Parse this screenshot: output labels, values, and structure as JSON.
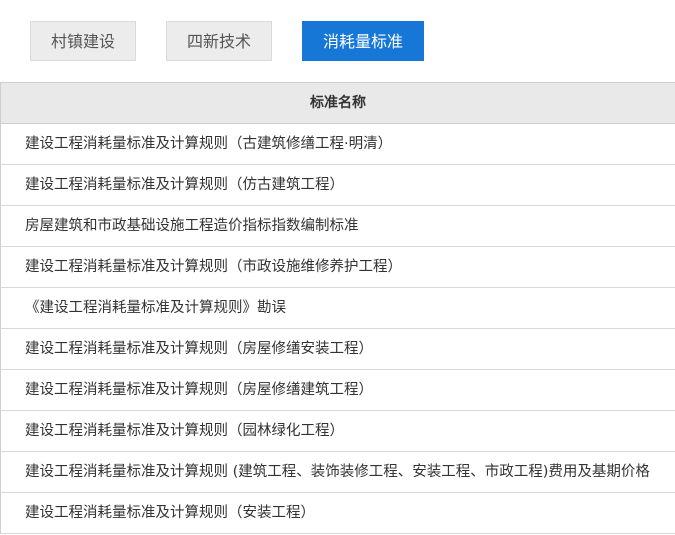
{
  "tabs": [
    {
      "label": "村镇建设",
      "active": false
    },
    {
      "label": "四新技术",
      "active": false
    },
    {
      "label": "消耗量标准",
      "active": true
    }
  ],
  "table": {
    "header": "标准名称",
    "rows": [
      "建设工程消耗量标准及计算规则（古建筑修缮工程·明清）",
      "建设工程消耗量标准及计算规则（仿古建筑工程）",
      "房屋建筑和市政基础设施工程造价指标指数编制标准",
      "建设工程消耗量标准及计算规则（市政设施维修养护工程）",
      "《建设工程消耗量标准及计算规则》勘误",
      "建设工程消耗量标准及计算规则（房屋修缮安装工程）",
      "建设工程消耗量标准及计算规则（房屋修缮建筑工程）",
      "建设工程消耗量标准及计算规则（园林绿化工程）",
      "建设工程消耗量标准及计算规则 (建筑工程、装饰装修工程、安装工程、市政工程)费用及基期价格",
      "建设工程消耗量标准及计算规则（安装工程）"
    ]
  },
  "colors": {
    "active_tab": "#1677d6",
    "inactive_tab": "#ececec",
    "header_bg": "#e9e9e9"
  }
}
